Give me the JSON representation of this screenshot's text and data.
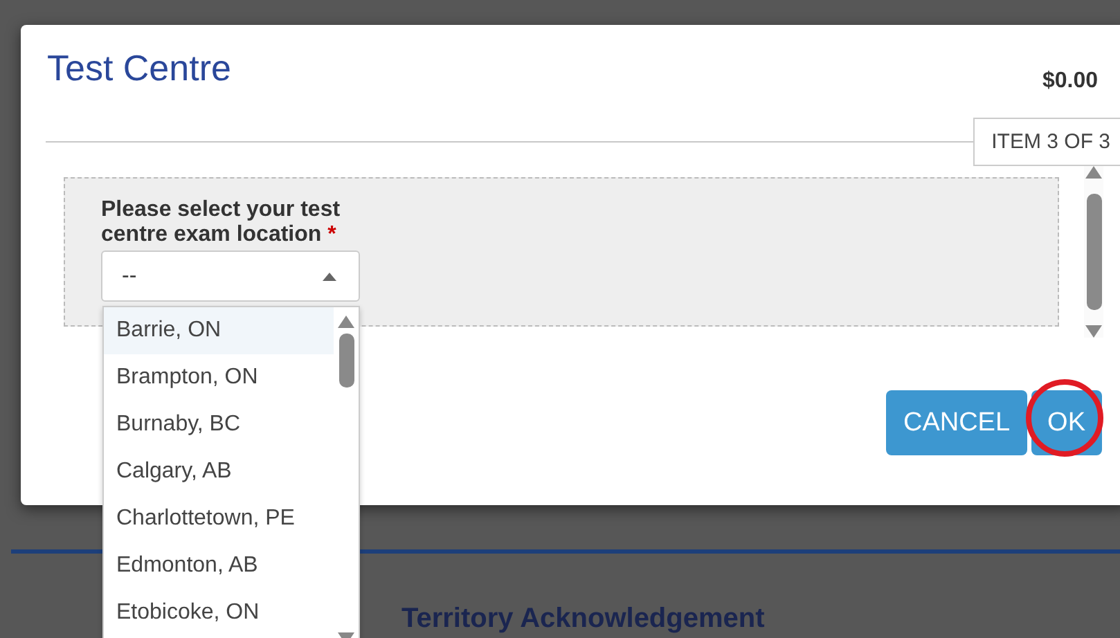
{
  "page": {
    "section_heading": "Territory Acknowledgement"
  },
  "dialog": {
    "title": "Test Centre",
    "price": "$0.00",
    "item_counter": "ITEM 3 OF 3",
    "field": {
      "label": "Please select your test centre exam location",
      "required_mark": "*",
      "value": "--",
      "expanded": true,
      "options": [
        {
          "label": "Barrie, ON",
          "selected": true
        },
        {
          "label": "Brampton, ON",
          "selected": false
        },
        {
          "label": "Burnaby, BC",
          "selected": false
        },
        {
          "label": "Calgary, AB",
          "selected": false
        },
        {
          "label": "Charlottetown, PE",
          "selected": false
        },
        {
          "label": "Edmonton, AB",
          "selected": false
        },
        {
          "label": "Etobicoke, ON",
          "selected": false
        }
      ]
    },
    "buttons": [
      {
        "label": "CANCEL",
        "circled": false
      },
      {
        "label": "OK",
        "circled": true
      }
    ]
  }
}
